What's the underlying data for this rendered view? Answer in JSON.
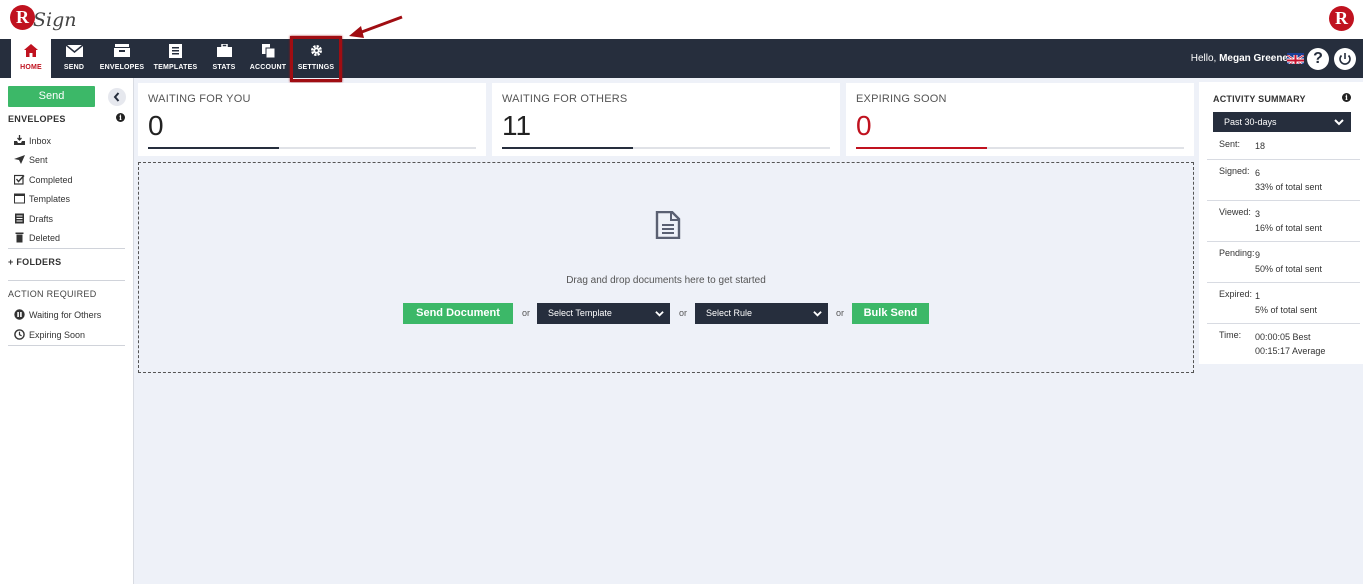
{
  "brand": {
    "logo_letter": "R",
    "logo_script": "Sign",
    "logo_right_letter": "R"
  },
  "nav": {
    "items": [
      {
        "label": "HOME"
      },
      {
        "label": "SEND"
      },
      {
        "label": "ENVELOPES"
      },
      {
        "label": "TEMPLATES"
      },
      {
        "label": "STATS"
      },
      {
        "label": "ACCOUNT"
      },
      {
        "label": "SETTINGS"
      }
    ],
    "hello": "Hello,",
    "user_name": "Megan Greene",
    "help_label": "?"
  },
  "sidebar": {
    "send_label": "Send",
    "envelopes_heading": "ENVELOPES",
    "info_glyph": "i",
    "envelopes": [
      {
        "label": "Inbox",
        "icon": "inbox-icon"
      },
      {
        "label": "Sent",
        "icon": "paper-plane-icon"
      },
      {
        "label": "Completed",
        "icon": "checkbox-icon"
      },
      {
        "label": "Templates",
        "icon": "template-icon"
      },
      {
        "label": "Drafts",
        "icon": "drafts-icon"
      },
      {
        "label": "Deleted",
        "icon": "trash-icon"
      }
    ],
    "folders_label": "+ FOLDERS",
    "action_heading": "ACTION REQUIRED",
    "actions": [
      {
        "label": "Waiting for Others",
        "icon": "pause-icon"
      },
      {
        "label": "Expiring Soon",
        "icon": "clock-icon"
      }
    ]
  },
  "cards": [
    {
      "title": "WAITING FOR YOU",
      "value": "0",
      "fill": 0.4,
      "color": "#262e3d"
    },
    {
      "title": "WAITING FOR OTHERS",
      "value": "11",
      "fill": 0.4,
      "color": "#262e3d"
    },
    {
      "title": "EXPIRING SOON",
      "value": "0",
      "fill": 0.4,
      "color": "#c0121f"
    }
  ],
  "dropzone": {
    "text": "Drag and drop documents here to get started",
    "send_document": "Send Document",
    "or": "or",
    "select_template": "Select Template",
    "select_rule": "Select Rule",
    "bulk_send": "Bulk Send"
  },
  "activity": {
    "title": "ACTIVITY SUMMARY",
    "period": "Past 30-days",
    "rows": [
      {
        "key": "Sent:",
        "line1": "18",
        "line2": ""
      },
      {
        "key": "Signed:",
        "line1": "6",
        "line2": "33% of total sent"
      },
      {
        "key": "Viewed:",
        "line1": "3",
        "line2": "16% of total sent"
      },
      {
        "key": "Pending:",
        "line1": "9",
        "line2": "50% of total sent"
      },
      {
        "key": "Expired:",
        "line1": "1",
        "line2": "5% of total sent"
      },
      {
        "key": "Time:",
        "line1": "00:00:05 Best",
        "line2": "00:15:17 Average"
      }
    ]
  },
  "colors": {
    "brand_red": "#c0121f",
    "navy": "#262e3d",
    "green": "#3cb868"
  }
}
